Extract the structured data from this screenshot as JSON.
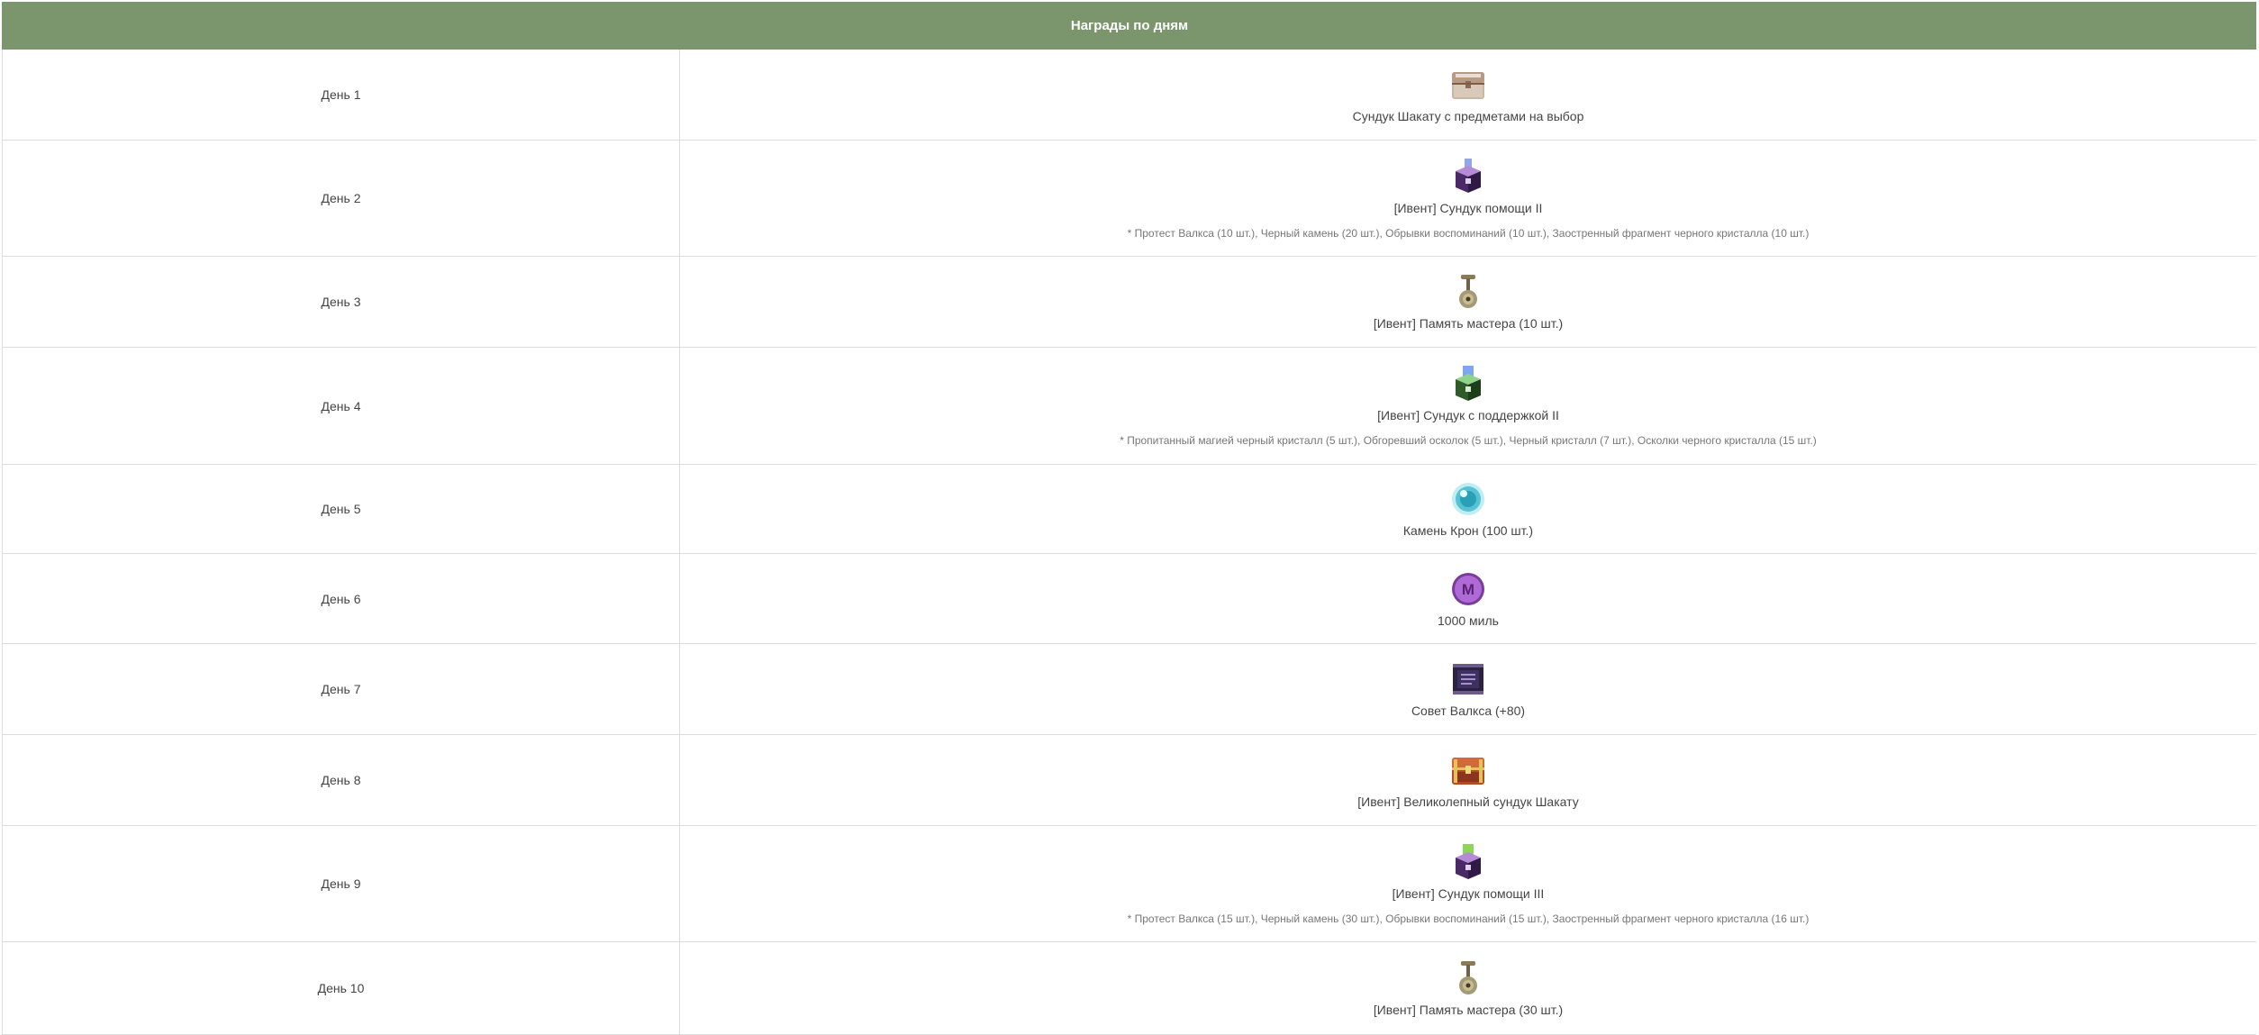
{
  "header": {
    "title": "Награды по дням"
  },
  "colors": {
    "header_bg": "#7b966c",
    "border": "#dcdcdc",
    "text": "#444444",
    "note_text": "#777777"
  },
  "rows": [
    {
      "day": "День 1",
      "icon": "treasure-chest-icon",
      "name": "Сундук Шакату с предметами на выбор",
      "note": ""
    },
    {
      "day": "День 2",
      "icon": "purple-support-box-icon",
      "name": "[Ивент] Сундук помощи II",
      "note": "*  Протест Валкса (10 шт.), Черный камень (20 шт.), Обрывки воспоминаний (10 шт.), Заостренный фрагмент черного кристалла (10 шт.)"
    },
    {
      "day": "День 3",
      "icon": "master-memory-icon",
      "name": "[Ивент] Память мастера (10 шт.)",
      "note": ""
    },
    {
      "day": "День 4",
      "icon": "green-support-box-icon",
      "name": "[Ивент] Сундук с поддержкой II",
      "note": "* Пропитанный магией черный кристалл (5 шт.), Обгоревший осколок (5 шт.), Черный кристалл (7 шт.), Осколки черного кристалла (15 шт.)"
    },
    {
      "day": "День 5",
      "icon": "cron-stone-icon",
      "name": "Камень Крон (100 шт.)",
      "note": ""
    },
    {
      "day": "День 6",
      "icon": "mileage-coin-icon",
      "name": "1000 миль",
      "note": ""
    },
    {
      "day": "День 7",
      "icon": "valks-advice-scroll-icon",
      "name": "Совет Валкса (+80)",
      "note": ""
    },
    {
      "day": "День 8",
      "icon": "magnificent-chest-icon",
      "name": "[Ивент] Великолепный сундук Шакату",
      "note": ""
    },
    {
      "day": "День 9",
      "icon": "purple-support-box-green-icon",
      "name": "[Ивент] Сундук помощи III",
      "note": "* Протест Валкса (15 шт.), Черный камень (30 шт.), Обрывки воспоминаний (15 шт.), Заостренный фрагмент черного кристалла (16 шт.)"
    },
    {
      "day": "День 10",
      "icon": "master-memory-icon",
      "name": "[Ивент] Память мастера (30 шт.)",
      "note": ""
    }
  ]
}
